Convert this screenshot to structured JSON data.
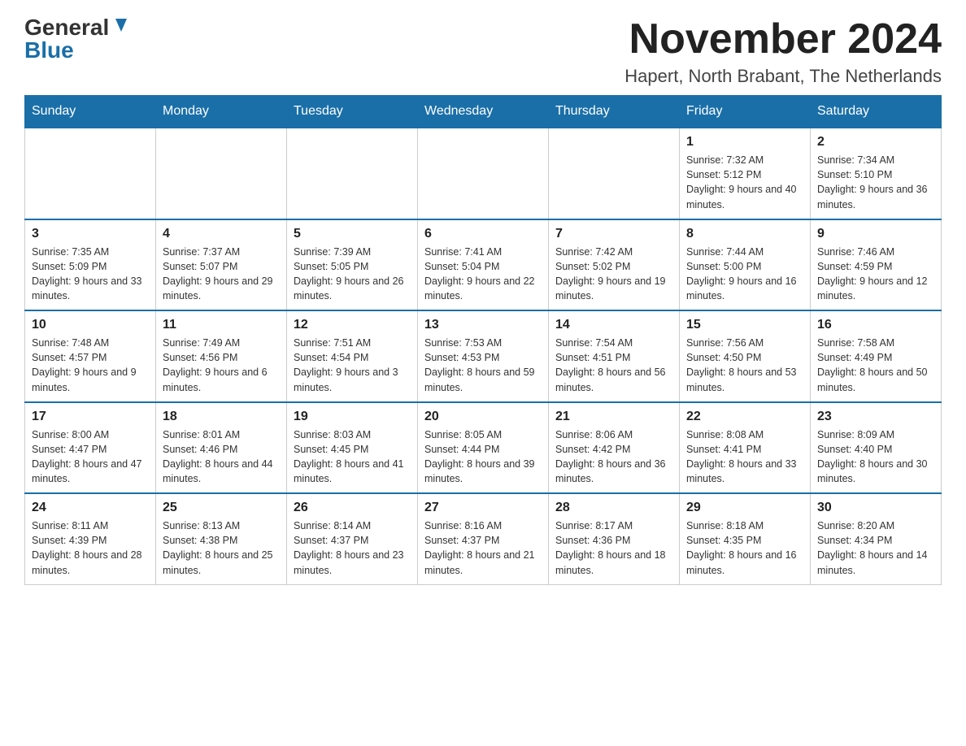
{
  "logo": {
    "general": "General",
    "blue": "Blue"
  },
  "title": "November 2024",
  "location": "Hapert, North Brabant, The Netherlands",
  "days_of_week": [
    "Sunday",
    "Monday",
    "Tuesday",
    "Wednesday",
    "Thursday",
    "Friday",
    "Saturday"
  ],
  "weeks": [
    [
      {
        "day": "",
        "info": ""
      },
      {
        "day": "",
        "info": ""
      },
      {
        "day": "",
        "info": ""
      },
      {
        "day": "",
        "info": ""
      },
      {
        "day": "",
        "info": ""
      },
      {
        "day": "1",
        "info": "Sunrise: 7:32 AM\nSunset: 5:12 PM\nDaylight: 9 hours and 40 minutes."
      },
      {
        "day": "2",
        "info": "Sunrise: 7:34 AM\nSunset: 5:10 PM\nDaylight: 9 hours and 36 minutes."
      }
    ],
    [
      {
        "day": "3",
        "info": "Sunrise: 7:35 AM\nSunset: 5:09 PM\nDaylight: 9 hours and 33 minutes."
      },
      {
        "day": "4",
        "info": "Sunrise: 7:37 AM\nSunset: 5:07 PM\nDaylight: 9 hours and 29 minutes."
      },
      {
        "day": "5",
        "info": "Sunrise: 7:39 AM\nSunset: 5:05 PM\nDaylight: 9 hours and 26 minutes."
      },
      {
        "day": "6",
        "info": "Sunrise: 7:41 AM\nSunset: 5:04 PM\nDaylight: 9 hours and 22 minutes."
      },
      {
        "day": "7",
        "info": "Sunrise: 7:42 AM\nSunset: 5:02 PM\nDaylight: 9 hours and 19 minutes."
      },
      {
        "day": "8",
        "info": "Sunrise: 7:44 AM\nSunset: 5:00 PM\nDaylight: 9 hours and 16 minutes."
      },
      {
        "day": "9",
        "info": "Sunrise: 7:46 AM\nSunset: 4:59 PM\nDaylight: 9 hours and 12 minutes."
      }
    ],
    [
      {
        "day": "10",
        "info": "Sunrise: 7:48 AM\nSunset: 4:57 PM\nDaylight: 9 hours and 9 minutes."
      },
      {
        "day": "11",
        "info": "Sunrise: 7:49 AM\nSunset: 4:56 PM\nDaylight: 9 hours and 6 minutes."
      },
      {
        "day": "12",
        "info": "Sunrise: 7:51 AM\nSunset: 4:54 PM\nDaylight: 9 hours and 3 minutes."
      },
      {
        "day": "13",
        "info": "Sunrise: 7:53 AM\nSunset: 4:53 PM\nDaylight: 8 hours and 59 minutes."
      },
      {
        "day": "14",
        "info": "Sunrise: 7:54 AM\nSunset: 4:51 PM\nDaylight: 8 hours and 56 minutes."
      },
      {
        "day": "15",
        "info": "Sunrise: 7:56 AM\nSunset: 4:50 PM\nDaylight: 8 hours and 53 minutes."
      },
      {
        "day": "16",
        "info": "Sunrise: 7:58 AM\nSunset: 4:49 PM\nDaylight: 8 hours and 50 minutes."
      }
    ],
    [
      {
        "day": "17",
        "info": "Sunrise: 8:00 AM\nSunset: 4:47 PM\nDaylight: 8 hours and 47 minutes."
      },
      {
        "day": "18",
        "info": "Sunrise: 8:01 AM\nSunset: 4:46 PM\nDaylight: 8 hours and 44 minutes."
      },
      {
        "day": "19",
        "info": "Sunrise: 8:03 AM\nSunset: 4:45 PM\nDaylight: 8 hours and 41 minutes."
      },
      {
        "day": "20",
        "info": "Sunrise: 8:05 AM\nSunset: 4:44 PM\nDaylight: 8 hours and 39 minutes."
      },
      {
        "day": "21",
        "info": "Sunrise: 8:06 AM\nSunset: 4:42 PM\nDaylight: 8 hours and 36 minutes."
      },
      {
        "day": "22",
        "info": "Sunrise: 8:08 AM\nSunset: 4:41 PM\nDaylight: 8 hours and 33 minutes."
      },
      {
        "day": "23",
        "info": "Sunrise: 8:09 AM\nSunset: 4:40 PM\nDaylight: 8 hours and 30 minutes."
      }
    ],
    [
      {
        "day": "24",
        "info": "Sunrise: 8:11 AM\nSunset: 4:39 PM\nDaylight: 8 hours and 28 minutes."
      },
      {
        "day": "25",
        "info": "Sunrise: 8:13 AM\nSunset: 4:38 PM\nDaylight: 8 hours and 25 minutes."
      },
      {
        "day": "26",
        "info": "Sunrise: 8:14 AM\nSunset: 4:37 PM\nDaylight: 8 hours and 23 minutes."
      },
      {
        "day": "27",
        "info": "Sunrise: 8:16 AM\nSunset: 4:37 PM\nDaylight: 8 hours and 21 minutes."
      },
      {
        "day": "28",
        "info": "Sunrise: 8:17 AM\nSunset: 4:36 PM\nDaylight: 8 hours and 18 minutes."
      },
      {
        "day": "29",
        "info": "Sunrise: 8:18 AM\nSunset: 4:35 PM\nDaylight: 8 hours and 16 minutes."
      },
      {
        "day": "30",
        "info": "Sunrise: 8:20 AM\nSunset: 4:34 PM\nDaylight: 8 hours and 14 minutes."
      }
    ]
  ]
}
